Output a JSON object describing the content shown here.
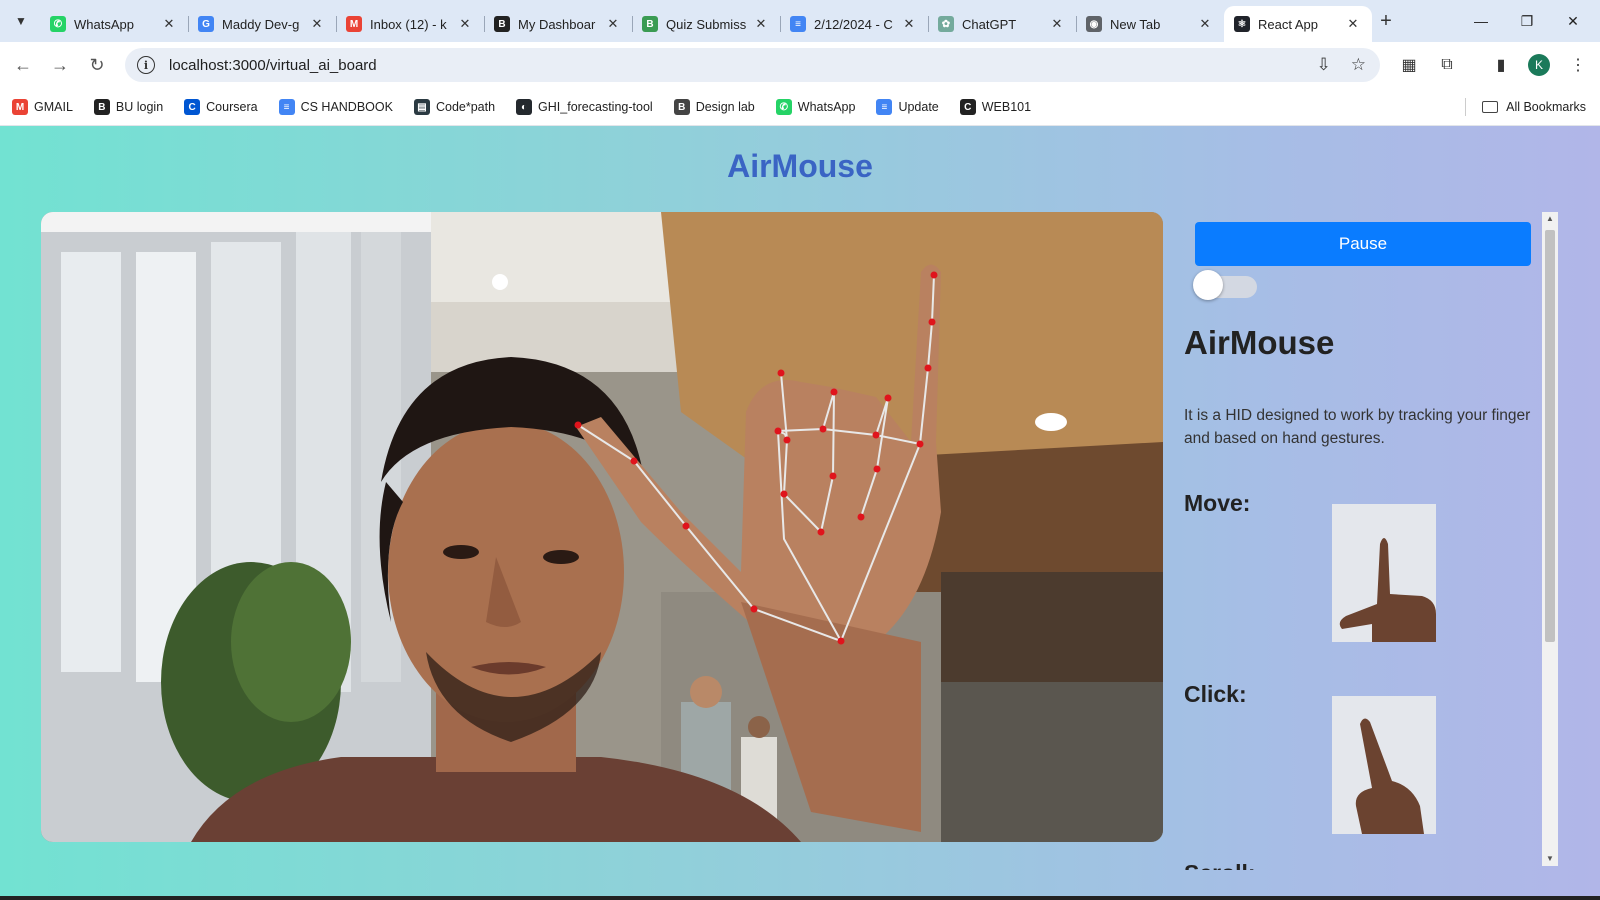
{
  "browser": {
    "tabs": [
      {
        "title": "WhatsApp",
        "icon": "whatsapp-icon",
        "color": "#25d366",
        "glyph": "✆"
      },
      {
        "title": "Maddy Dev-g",
        "icon": "google-icon",
        "color": "#4285f4",
        "glyph": "G"
      },
      {
        "title": "Inbox (12) - k",
        "icon": "gmail-icon",
        "color": "#ea4335",
        "glyph": "M"
      },
      {
        "title": "My Dashboar",
        "icon": "blackboard-icon",
        "color": "#222222",
        "glyph": "B"
      },
      {
        "title": "Quiz Submiss",
        "icon": "gradescope-icon",
        "color": "#3a9b53",
        "glyph": "B"
      },
      {
        "title": "2/12/2024 - C",
        "icon": "docs-icon",
        "color": "#4285f4",
        "glyph": "≡"
      },
      {
        "title": "ChatGPT",
        "icon": "chatgpt-icon",
        "color": "#74aa9c",
        "glyph": "✿"
      },
      {
        "title": "New Tab",
        "icon": "chrome-icon",
        "color": "#5f6368",
        "glyph": "◉"
      },
      {
        "title": "React App",
        "icon": "react-icon",
        "color": "#20232a",
        "glyph": "⚛"
      }
    ],
    "new_tab_label": "+",
    "window_controls": {
      "minimize": "—",
      "restore": "❐",
      "close": "✕"
    },
    "url": "localhost:3000/virtual_ai_board",
    "profile_initial": "K",
    "bookmarks": [
      {
        "label": "GMAIL",
        "icon": "gmail-icon",
        "color": "#ea4335",
        "glyph": "M"
      },
      {
        "label": "BU login",
        "icon": "blackboard-icon",
        "color": "#222222",
        "glyph": "B"
      },
      {
        "label": "Coursera",
        "icon": "coursera-icon",
        "color": "#0056d2",
        "glyph": "C"
      },
      {
        "label": "CS HANDBOOK",
        "icon": "docs-icon",
        "color": "#4285f4",
        "glyph": "≡"
      },
      {
        "label": "Code*path",
        "icon": "codepath-icon",
        "color": "#2b3a42",
        "glyph": "▤"
      },
      {
        "label": "GHI_forecasting-tool",
        "icon": "github-icon",
        "color": "#24292e",
        "glyph": "◐"
      },
      {
        "label": "Design lab",
        "icon": "blackboard-icon",
        "color": "#444444",
        "glyph": "B"
      },
      {
        "label": "WhatsApp",
        "icon": "whatsapp-icon",
        "color": "#25d366",
        "glyph": "✆"
      },
      {
        "label": "Update",
        "icon": "docs-icon",
        "color": "#4285f4",
        "glyph": "≡"
      },
      {
        "label": "WEB101",
        "icon": "codepath-c-icon",
        "color": "#222222",
        "glyph": "C"
      }
    ],
    "all_bookmarks": "All Bookmarks"
  },
  "app": {
    "title": "AirMouse",
    "pause_label": "Pause",
    "toggle_on": false,
    "panel_title": "AirMouse",
    "description": "It is a HID designed to work by tracking your finger and based on hand gestures.",
    "gestures": [
      {
        "label": "Move:",
        "image": "move-gesture-image"
      },
      {
        "label": "Click:",
        "image": "click-gesture-image"
      },
      {
        "label": "Scroll:",
        "image": "scroll-gesture-image"
      }
    ],
    "accent_color": "#0a7cff",
    "title_color": "#3a64c4"
  }
}
